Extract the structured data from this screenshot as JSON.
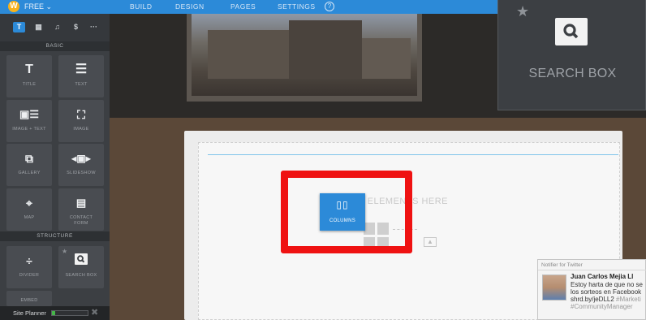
{
  "topbar": {
    "plan_label": "FREE ⌄",
    "nav": [
      "BUILD",
      "DESIGN",
      "PAGES",
      "SETTINGS"
    ],
    "help_glyph": "?"
  },
  "sidebar": {
    "tabs": [
      "T",
      "▦",
      "♫",
      "$",
      "···"
    ],
    "section_basic": "BASIC",
    "section_structure": "STRUCTURE",
    "tiles_basic": [
      {
        "label": "TITLE",
        "icon": "title-icon"
      },
      {
        "label": "TEXT",
        "icon": "text-lines-icon"
      },
      {
        "label": "IMAGE + TEXT",
        "icon": "image-text-icon"
      },
      {
        "label": "IMAGE",
        "icon": "image-icon"
      },
      {
        "label": "GALLERY",
        "icon": "gallery-icon"
      },
      {
        "label": "SLIDESHOW",
        "icon": "slideshow-icon"
      },
      {
        "label": "MAP",
        "icon": "map-icon"
      },
      {
        "label": "CONTACT FORM",
        "icon": "contact-form-icon"
      }
    ],
    "tiles_structure": [
      {
        "label": "DIVIDER",
        "icon": "divider-icon"
      },
      {
        "label": "SEARCH BOX",
        "icon": "search-icon"
      }
    ],
    "partial_tile_label": "EMBED",
    "site_planner": {
      "label": "Site Planner",
      "progress": 0.1,
      "close": "✖"
    }
  },
  "canvas": {
    "drop_text": "G ELEMENTS HERE",
    "dragged_tile_label": "COLUMNS",
    "dragged_tile_glyph": "▯▯"
  },
  "floating_tile": {
    "label": "SEARCH BOX"
  },
  "notifier": {
    "header": "Notifier for Twitter",
    "name": "Juan Carlos Mejia Ll",
    "lines": [
      "Estoy harta de que no se",
      "los sorteos en Facebook",
      "shrd.by/jeDLL2",
      "#Marketi",
      "#CommunityManager"
    ]
  },
  "colors": {
    "accent": "#2c8ad8",
    "highlight": "#ef1212",
    "progress": "#45b649"
  }
}
